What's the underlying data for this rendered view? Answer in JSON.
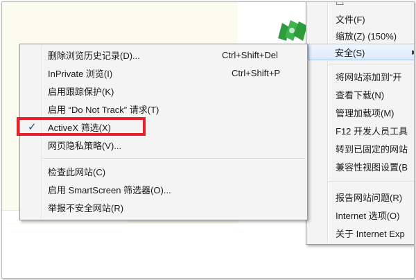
{
  "right_menu": {
    "items": [
      {
        "label": "文件(F)"
      },
      {
        "label": "缩放(Z) (150%)"
      },
      {
        "label": "安全(S)"
      },
      {
        "label": "将网站添加到“开"
      },
      {
        "label": "查看下载(N)"
      },
      {
        "label": "管理加载项(M)"
      },
      {
        "label": "F12 开发人员工具"
      },
      {
        "label": "转到已固定的网站"
      },
      {
        "label": "兼容性视图设置(B"
      },
      {
        "label": "报告网站问题(R)"
      },
      {
        "label": "Internet 选项(O)"
      },
      {
        "label": "关于 Internet Exp"
      }
    ]
  },
  "left_menu": {
    "items": [
      {
        "label": "删除浏览历史记录(D)...",
        "accel": "Ctrl+Shift+Del"
      },
      {
        "label": "InPrivate 浏览(I)",
        "accel": "Ctrl+Shift+P"
      },
      {
        "label": "启用跟踪保护(K)"
      },
      {
        "label": "启用 “Do Not Track” 请求(T)"
      },
      {
        "label": "ActiveX 筛选(X)",
        "check": "✓"
      },
      {
        "label": "网页隐私策略(V)..."
      },
      {
        "label": "检查此网站(C)"
      },
      {
        "label": "启用 SmartScreen 筛选器(O)..."
      },
      {
        "label": "举报不安全网站(R)"
      }
    ]
  },
  "colors": {
    "highlight_box": "#e8202a",
    "menu_bg": "#f4f4f4",
    "checkmark": "#1e3f8f"
  }
}
